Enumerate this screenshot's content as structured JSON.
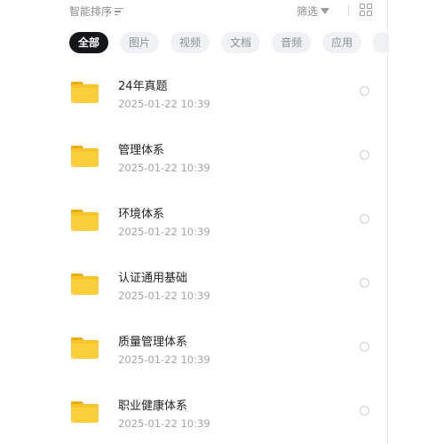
{
  "toolbar": {
    "sort_label": "智能排序",
    "filter_label": "筛选"
  },
  "tabs": [
    {
      "label": "全部",
      "active": true
    },
    {
      "label": "图片",
      "active": false
    },
    {
      "label": "视频",
      "active": false
    },
    {
      "label": "文档",
      "active": false
    },
    {
      "label": "音频",
      "active": false
    },
    {
      "label": "应用",
      "active": false
    }
  ],
  "files": [
    {
      "name": "24年真题",
      "date": "2025-01-22  10:39"
    },
    {
      "name": "管理体系",
      "date": "2025-01-22  10:39"
    },
    {
      "name": "环境体系",
      "date": "2025-01-22  10:39"
    },
    {
      "name": "认证通用基础",
      "date": "2025-01-22  10:39"
    },
    {
      "name": "质量管理体系",
      "date": "2025-01-22  10:39"
    },
    {
      "name": "职业健康体系",
      "date": "2025-01-22  10:39"
    }
  ],
  "icons": {
    "sort": "sort-lines-icon",
    "filter": "funnel-icon",
    "view": "grid-view-icon",
    "item": "folder-icon",
    "select": "radio-icon"
  },
  "colors": {
    "active_tab_bg": "#15161a",
    "inactive_tab_bg": "#f0f1f4",
    "folder": "#f8c42a"
  }
}
